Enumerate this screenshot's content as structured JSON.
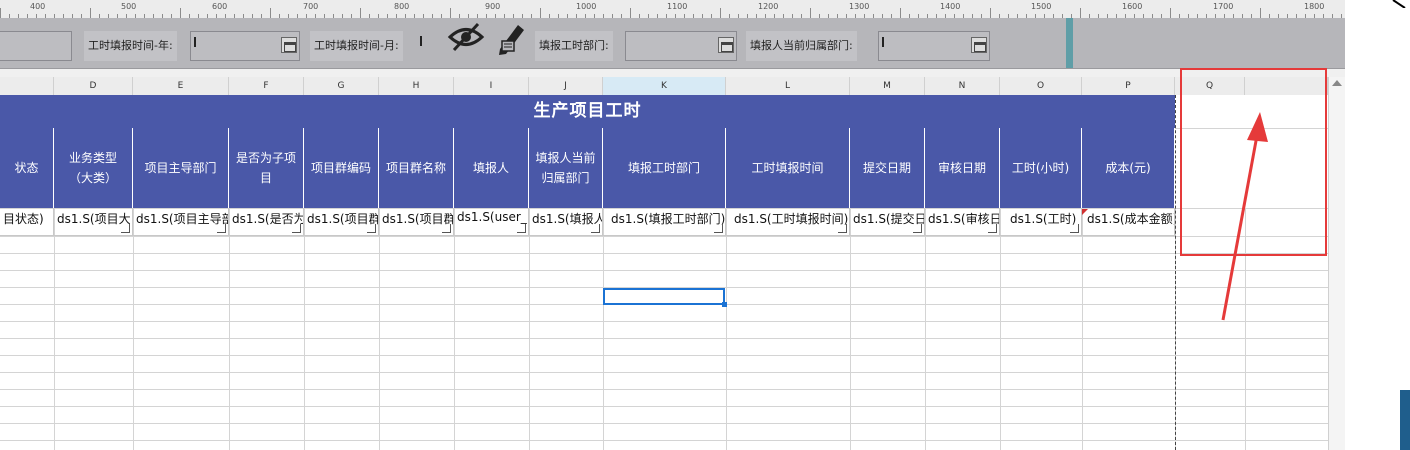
{
  "ruler": {
    "labels": [
      "400",
      "500",
      "600",
      "700",
      "800",
      "900",
      "1000",
      "1100",
      "1200",
      "1300",
      "1400",
      "1500",
      "1600",
      "1700",
      "1800"
    ]
  },
  "toolbar": {
    "first_field_value": "",
    "year_label": "工时填报时间-年:",
    "month_label": "工时填报时间-月:",
    "dept_label": "填报工时部门:",
    "current_dept_label": "填报人当前归属部门:"
  },
  "columns": {
    "D": "D",
    "E": "E",
    "F": "F",
    "G": "G",
    "H": "H",
    "I": "I",
    "J": "J",
    "K": "K",
    "L": "L",
    "M": "M",
    "N": "N",
    "O": "O",
    "P": "P",
    "Q": "Q"
  },
  "sheet": {
    "title": "生产项目工时",
    "headers": {
      "c": "状态",
      "d": "业务类型（大类）",
      "e": "项目主导部门",
      "f": "是否为子项目",
      "g": "项目群编码",
      "h": "项目群名称",
      "i": "填报人",
      "j": "填报人当前归属部门",
      "k": "填报工时部门",
      "l": "工时填报时间",
      "m": "提交日期",
      "n": "审核日期",
      "o": "工时(小时)",
      "p": "成本(元)"
    },
    "cells": {
      "c": "目状态)",
      "d": "ds1.S(项目大",
      "e": "ds1.S(项目主导部",
      "f": "ds1.S(是否为",
      "g": "ds1.S(项目群",
      "h": "ds1.S(项目群",
      "i": "ds1.S(user_",
      "j": "ds1.S(填报人",
      "k": "ds1.S(填报工时部门)",
      "l": "ds1.S(工时填报时间)",
      "m": "ds1.S(提交日",
      "n": "ds1.S(审核日",
      "o": "ds1.S(工时)",
      "p": "ds1.S(成本金额)"
    }
  },
  "annotation": {
    "highlight_color": "#e53a3a"
  }
}
